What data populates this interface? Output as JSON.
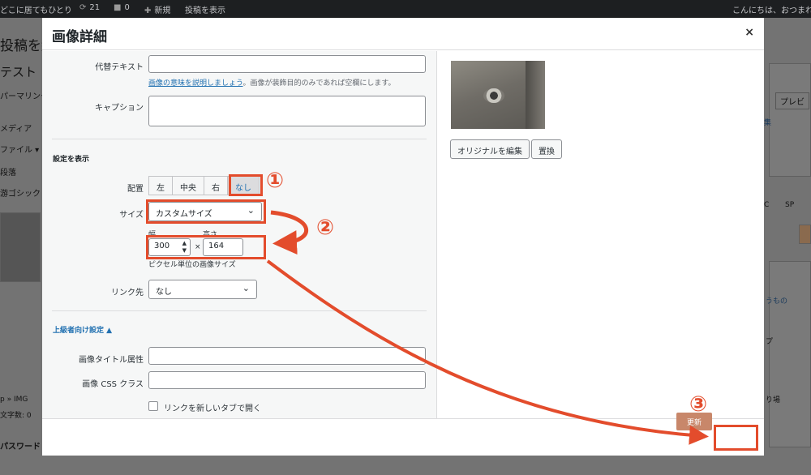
{
  "adminbar": {
    "site_name": "どこに居てもひとり",
    "updates_count": "21",
    "comments_count": "0",
    "new_label": "新規",
    "view_post_label": "投稿を表示",
    "greeting": "こんにちは、おつまれ"
  },
  "background": {
    "title_fragment": "投稿を編",
    "test_label": "テスト",
    "permalink_label": "パーマリンク",
    "media_label": "メディア",
    "file_label": "ファイル ▾",
    "paragraph_label": "段落",
    "font_label": "游ゴシック",
    "preview_label": "プレビ",
    "edit_link": "集",
    "pc_label": "C",
    "sp_label": "SP",
    "path_label": "p » IMG",
    "char_count": "文字数: 0",
    "password_label": "パスワード",
    "side_text_1": "うもの",
    "side_text_2": "プ",
    "side_text_3": "り場"
  },
  "modal": {
    "title": "画像詳細",
    "close_icon": "×",
    "alt_text_label": "代替テキスト",
    "alt_help_link": "画像の意味を説明しましょう",
    "alt_help_text": "。画像が装飾目的のみであれば空欄にします。",
    "caption_label": "キャプション",
    "display_settings_heading": "設定を表示",
    "align_label": "配置",
    "align_options": [
      "左",
      "中央",
      "右",
      "なし"
    ],
    "align_selected": "なし",
    "size_label": "サイズ",
    "size_value": "カスタムサイズ",
    "width_label": "幅",
    "height_label": "高さ",
    "width_value": "300",
    "height_value": "164",
    "times_sign": "×",
    "pixel_help": "ピクセル単位の画像サイズ",
    "link_label": "リンク先",
    "link_value": "なし",
    "advanced_toggle": "上級者向け設定 ▲",
    "image_title_label": "画像タイトル属性",
    "css_class_label": "画像 CSS クラス",
    "new_tab_label": "リンクを新しいタブで開く",
    "edit_original_button": "オリジナルを編集",
    "replace_button": "置換",
    "update_button": "更新"
  },
  "annotations": [
    "①",
    "②",
    "③"
  ],
  "colors": {
    "accent": "#e34c2c",
    "link": "#2271b1",
    "update_button": "#c8876a"
  }
}
